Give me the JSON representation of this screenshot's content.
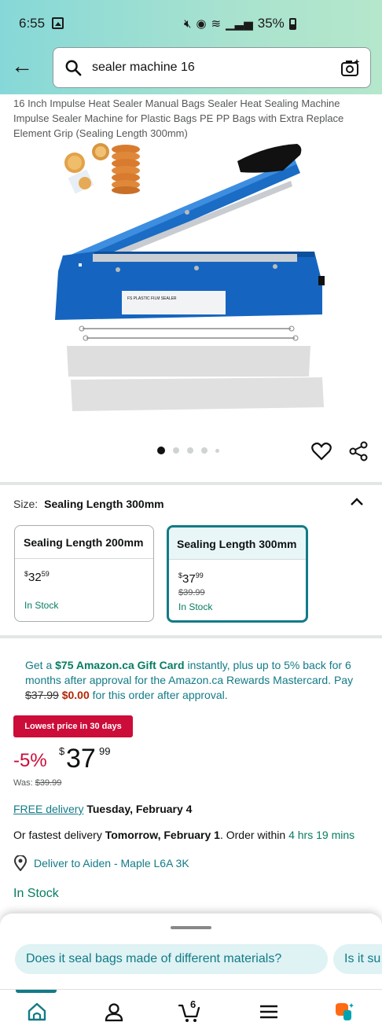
{
  "status_bar": {
    "time": "6:55",
    "battery": "35%",
    "icons": [
      "image-icon",
      "mute-icon",
      "hotspot-icon",
      "wifi-icon",
      "signal-icon",
      "battery-icon"
    ]
  },
  "search": {
    "query": "sealer machine 16",
    "icons": [
      "back-arrow-icon",
      "search-icon",
      "camera-icon"
    ]
  },
  "product": {
    "title": "16 Inch Impulse Heat Sealer Manual Bags Sealer Heat Sealing Machine Impulse Sealer Machine for Plastic Bags PE PP Bags with Extra Replace Element Grip (Sealing Length 300mm)",
    "image_label": "FS PLASTIC FILM SEALER",
    "image_count": 5,
    "active_image": 1
  },
  "size": {
    "label": "Size:",
    "selected": "Sealing Length 300mm",
    "options": [
      {
        "name": "Sealing Length 200mm",
        "price_currency": "$",
        "price_whole": "32",
        "price_fraction": "59",
        "was": "",
        "stock": "In Stock"
      },
      {
        "name": "Sealing Length 300mm",
        "price_currency": "$",
        "price_whole": "37",
        "price_fraction": "99",
        "was": "$39.99",
        "stock": "In Stock"
      }
    ]
  },
  "promo": {
    "prefix": "Get a ",
    "gift_card": "$75 Amazon.ca Gift Card",
    "middle": " instantly, plus up to 5% back for 6 months after approval for the Amazon.ca Rewards Mastercard. Pay ",
    "struck_price": "$37.99",
    "zero_price": "$0.00",
    "suffix": " for this order after approval."
  },
  "pricing": {
    "badge": "Lowest price in 30 days",
    "discount": "-5%",
    "currency": "$",
    "whole": "37",
    "fraction": "99",
    "was_label": "Was: ",
    "was_price": "$39.99"
  },
  "delivery": {
    "free_label": "FREE delivery",
    "free_date": "Tuesday, February 4",
    "fastest_prefix": "Or fastest delivery ",
    "fastest_date": "Tomorrow, February 1",
    "order_within_prefix": ". Order within ",
    "order_within": "4 hrs 19 mins",
    "deliver_to": "Deliver to Aiden - Maple L6A 3K",
    "stock": "In Stock"
  },
  "suggestions": [
    "Does it seal bags made of different materials?",
    "Is it su"
  ],
  "bottom_nav": {
    "items": [
      "home-icon",
      "account-icon",
      "cart-icon",
      "menu-icon",
      "rufus-icon"
    ],
    "cart_count": "6"
  },
  "colors": {
    "teal": "#127b87",
    "green": "#067d62",
    "deal_red": "#cc0c39",
    "sealer_blue": "#1565c0"
  }
}
